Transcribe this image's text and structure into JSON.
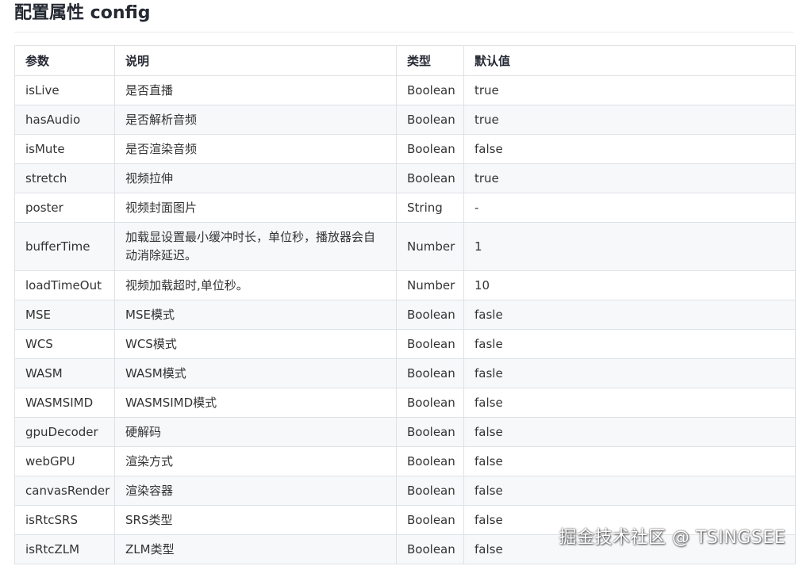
{
  "section": {
    "title": "配置属性 config"
  },
  "table": {
    "headers": [
      "参数",
      "说明",
      "类型",
      "默认值"
    ],
    "rows": [
      [
        "isLive",
        "是否直播",
        "Boolean",
        "true"
      ],
      [
        "hasAudio",
        "是否解析音频",
        "Boolean",
        "true"
      ],
      [
        "isMute",
        "是否渲染音频",
        "Boolean",
        "false"
      ],
      [
        "stretch",
        "视频拉伸",
        "Boolean",
        "true"
      ],
      [
        "poster",
        "视频封面图片",
        "String",
        "-"
      ],
      [
        "bufferTime",
        "加载显设置最小缓冲时长，单位秒，播放器会自动消除延迟。",
        "Number",
        "1"
      ],
      [
        "loadTimeOut",
        "视频加载超时,单位秒。",
        "Number",
        "10"
      ],
      [
        "MSE",
        "MSE模式",
        "Boolean",
        "fasle"
      ],
      [
        "WCS",
        "WCS模式",
        "Boolean",
        "fasle"
      ],
      [
        "WASM",
        "WASM模式",
        "Boolean",
        "fasle"
      ],
      [
        "WASMSIMD",
        "WASMSIMD模式",
        "Boolean",
        "false"
      ],
      [
        "gpuDecoder",
        "硬解码",
        "Boolean",
        "false"
      ],
      [
        "webGPU",
        "渲染方式",
        "Boolean",
        "false"
      ],
      [
        "canvasRender",
        "渲染容器",
        "Boolean",
        "false"
      ],
      [
        "isRtcSRS",
        "SRS类型",
        "Boolean",
        "false"
      ],
      [
        "isRtcZLM",
        "ZLM类型",
        "Boolean",
        "false"
      ]
    ]
  },
  "watermark": "掘金技术社区 @ TSINGSEE"
}
